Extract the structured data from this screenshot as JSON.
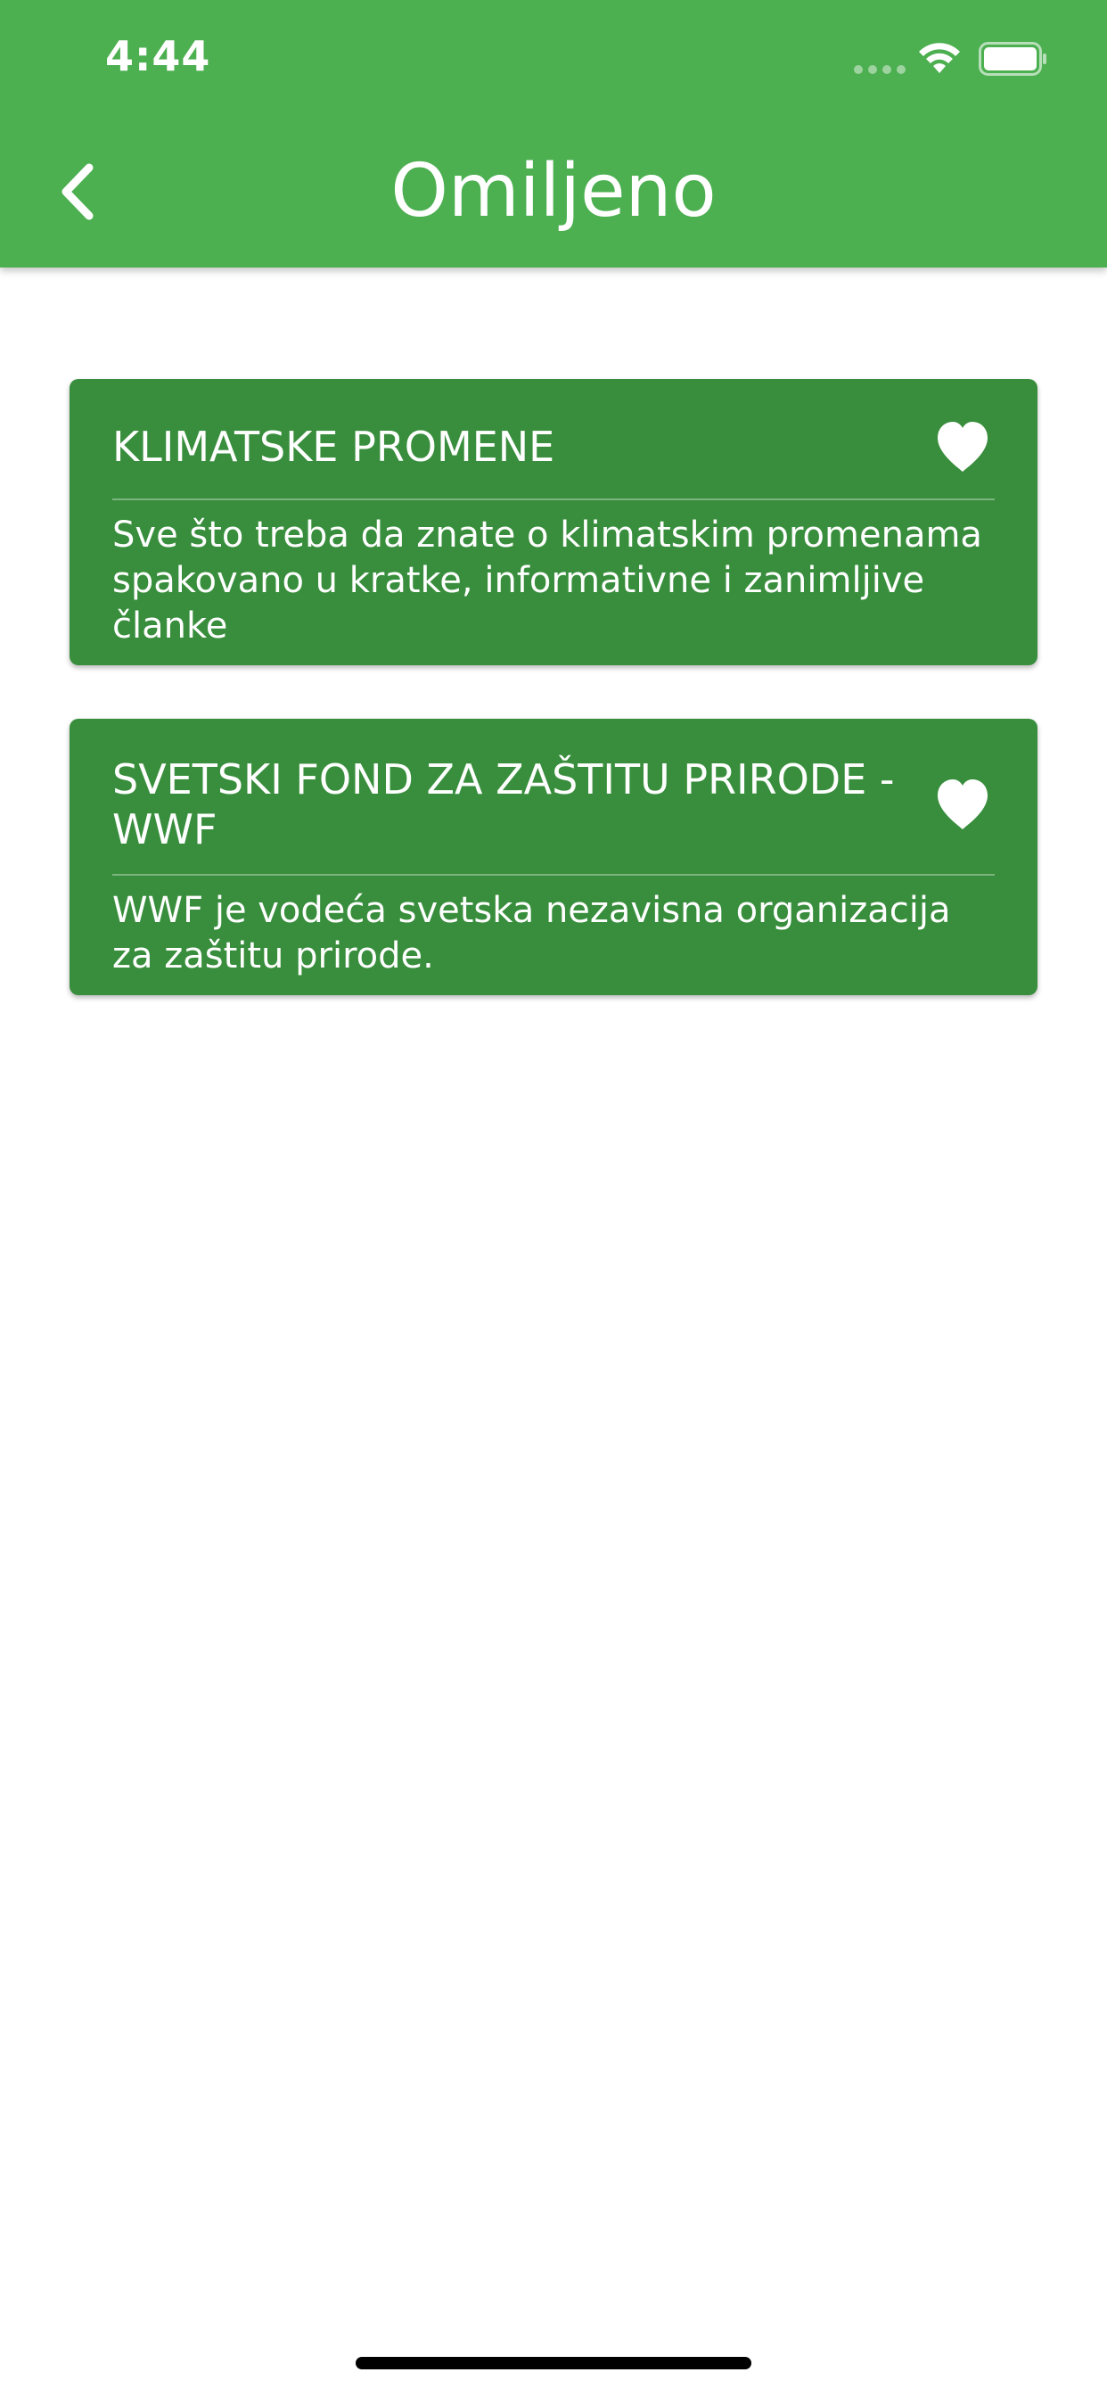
{
  "status_bar": {
    "time": "4:44"
  },
  "header": {
    "title": "Omiljeno",
    "back_icon": "chevron-left-icon"
  },
  "favorites": [
    {
      "title": "KLIMATSKE PROMENE",
      "description": "Sve što treba da znate o klimatskim promenama spakovano u kratke, informativne i zanimljive članke",
      "favorite_icon": "heart-icon"
    },
    {
      "title": "SVETSKI FOND ZA ZAŠTITU PRIRODE - WWF",
      "description": "WWF je vodeća svetska nezavisna organizacija za zaštitu prirode.",
      "favorite_icon": "heart-icon"
    }
  ],
  "colors": {
    "app_bar": "#4caf50",
    "card": "#388e3c",
    "background": "#ffffff",
    "text": "#ffffff"
  }
}
